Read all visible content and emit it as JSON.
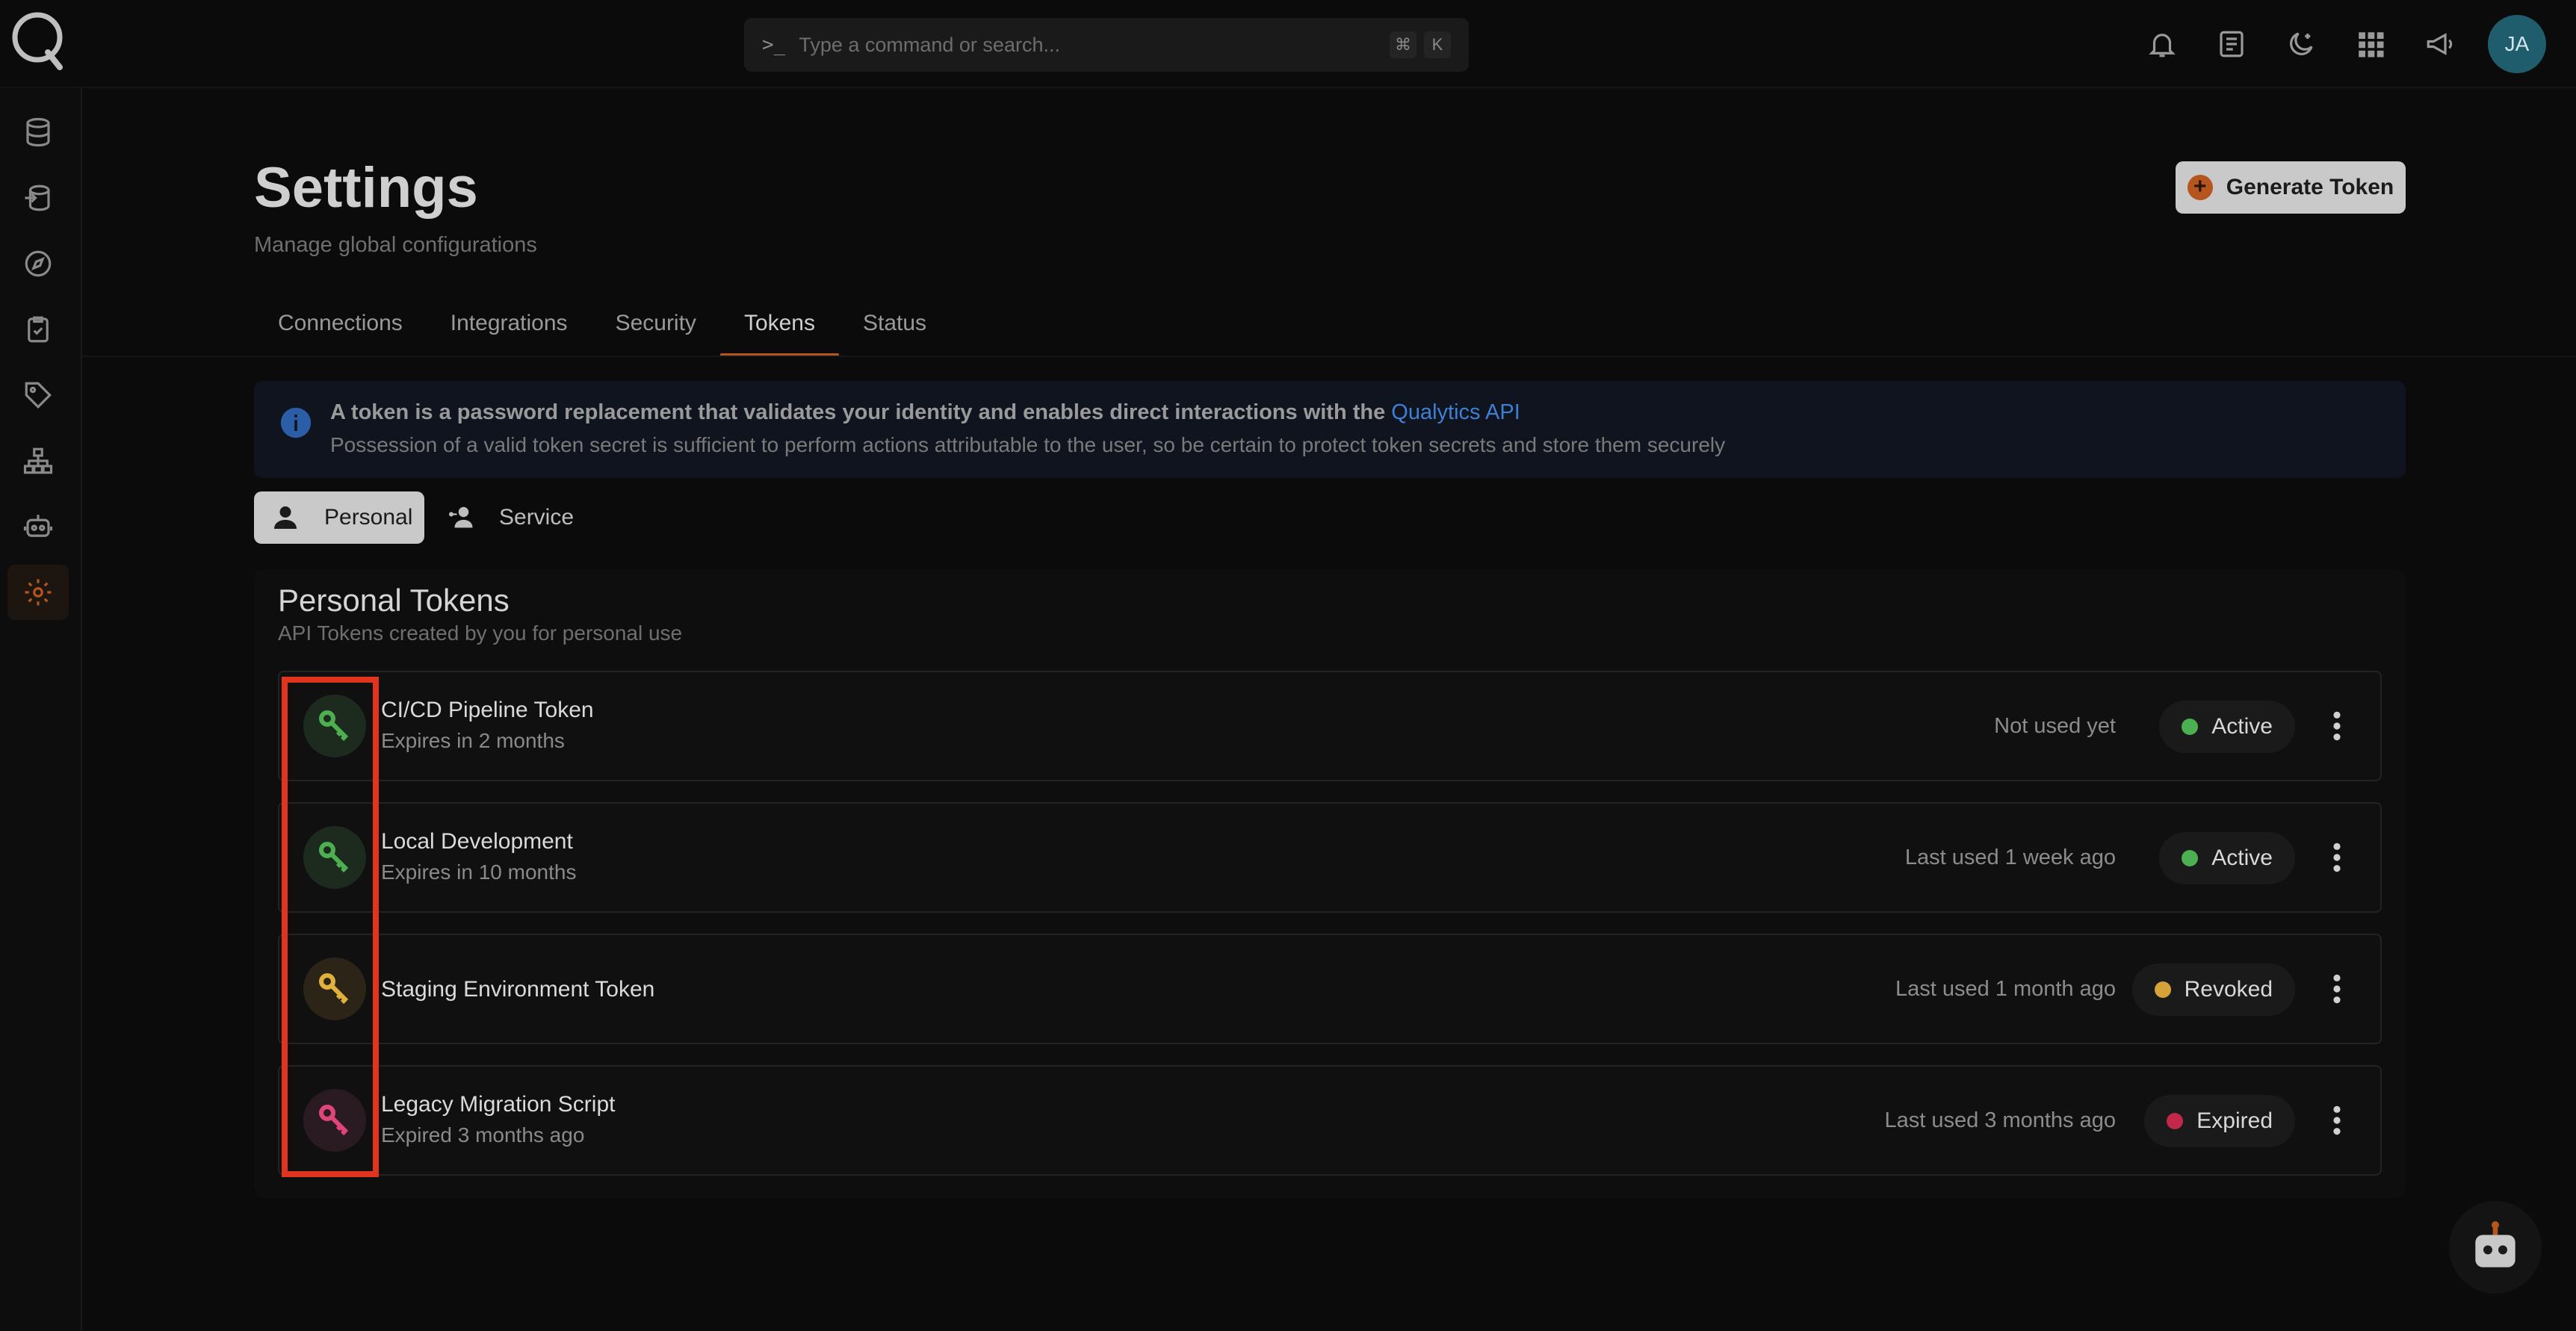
{
  "app": {
    "avatar_initials": "JA"
  },
  "search": {
    "placeholder": "Type a command or search...",
    "shortcut_mod": "⌘",
    "shortcut_key": "K"
  },
  "header": {
    "title": "Settings",
    "subtitle": "Manage global configurations",
    "generate_label": "Generate Token"
  },
  "tabs": [
    {
      "label": "Connections"
    },
    {
      "label": "Integrations"
    },
    {
      "label": "Security"
    },
    {
      "label": "Tokens",
      "active": true
    },
    {
      "label": "Status"
    }
  ],
  "info": {
    "line1": "A token is a password replacement that validates your identity and enables direct interactions with the ",
    "link": "Qualytics API",
    "line2": "Possession of a valid token secret is sufficient to perform actions attributable to the user, so be certain to protect token secrets and store them securely"
  },
  "toggle": {
    "personal": "Personal",
    "service": "Service",
    "selected": "Personal"
  },
  "card": {
    "title": "Personal Tokens",
    "subtitle": "API Tokens created by you for personal use"
  },
  "tokens": [
    {
      "name": "CI/CD Pipeline Token",
      "expiry": "Expires in 2 months",
      "last_used": "Not used yet",
      "status": "Active",
      "color": "#4caf50"
    },
    {
      "name": "Local Development",
      "expiry": "Expires in 10 months",
      "last_used": "Last used 1 week ago",
      "status": "Active",
      "color": "#4caf50"
    },
    {
      "name": "Staging Environment Token",
      "expiry": "",
      "last_used": "Last used 1 month ago",
      "status": "Revoked",
      "color": "#d6a33a"
    },
    {
      "name": "Legacy Migration Script",
      "expiry": "Expired 3 months ago",
      "last_used": "Last used 3 months ago",
      "status": "Expired",
      "color": "#c2284a"
    }
  ],
  "colors": {
    "accent": "#b4561e",
    "link": "#3f7fd6",
    "highlight": "#e1341e"
  }
}
